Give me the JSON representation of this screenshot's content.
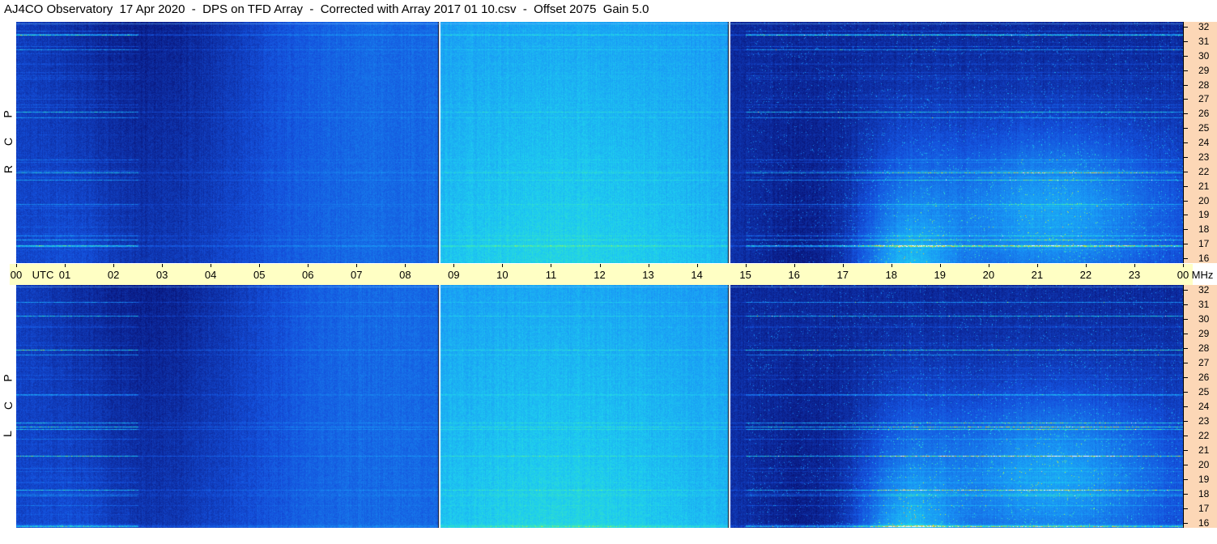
{
  "title": "AJ4CO Observatory  17 Apr 2020  -  DPS on TFD Array  -  Corrected with Array 2017 01 10.csv  -  Offset 2075  Gain 5.0",
  "panels": [
    {
      "id": "rcp",
      "polarization_letters": [
        "R",
        "C",
        "P"
      ]
    },
    {
      "id": "lcp",
      "polarization_letters": [
        "L",
        "C",
        "P"
      ]
    }
  ],
  "time_axis": {
    "unit_label": "UTC",
    "freq_unit_label": "MHz",
    "ticks": [
      "00",
      "01",
      "02",
      "03",
      "04",
      "05",
      "06",
      "07",
      "08",
      "09",
      "10",
      "11",
      "12",
      "13",
      "14",
      "15",
      "16",
      "17",
      "18",
      "19",
      "20",
      "21",
      "22",
      "23",
      "00"
    ]
  },
  "freq_axis": {
    "ticks": [
      16,
      17,
      18,
      19,
      20,
      21,
      22,
      23,
      24,
      25,
      26,
      27,
      28,
      29,
      30,
      31,
      32
    ]
  },
  "colors": {
    "axis_band": "#ffffc4",
    "freq_band": "#fcd7b6",
    "background_dark": "#020230",
    "background_blue": "#1450d8",
    "background_cyan": "#1ec8f0"
  },
  "chart_data": {
    "type": "heatmap",
    "title": "AJ4CO Observatory  17 Apr 2020  -  DPS on TFD Array  -  Corrected with Array 2017 01 10.csv  -  Offset 2075  Gain 5.0",
    "xlabel": "UTC",
    "ylabel": "MHz",
    "x_range_hours": [
      0,
      24
    ],
    "y_range_mhz": [
      16,
      32
    ],
    "panels": [
      "RCP",
      "LCP"
    ],
    "calibration_breaks_utc_hours": [
      8.7,
      14.65
    ],
    "notes": "Dynamic spectrogram; intensity increases toward cyan/green/yellow around 09-14 UTC and 18-22 UTC at 16-22 MHz"
  }
}
